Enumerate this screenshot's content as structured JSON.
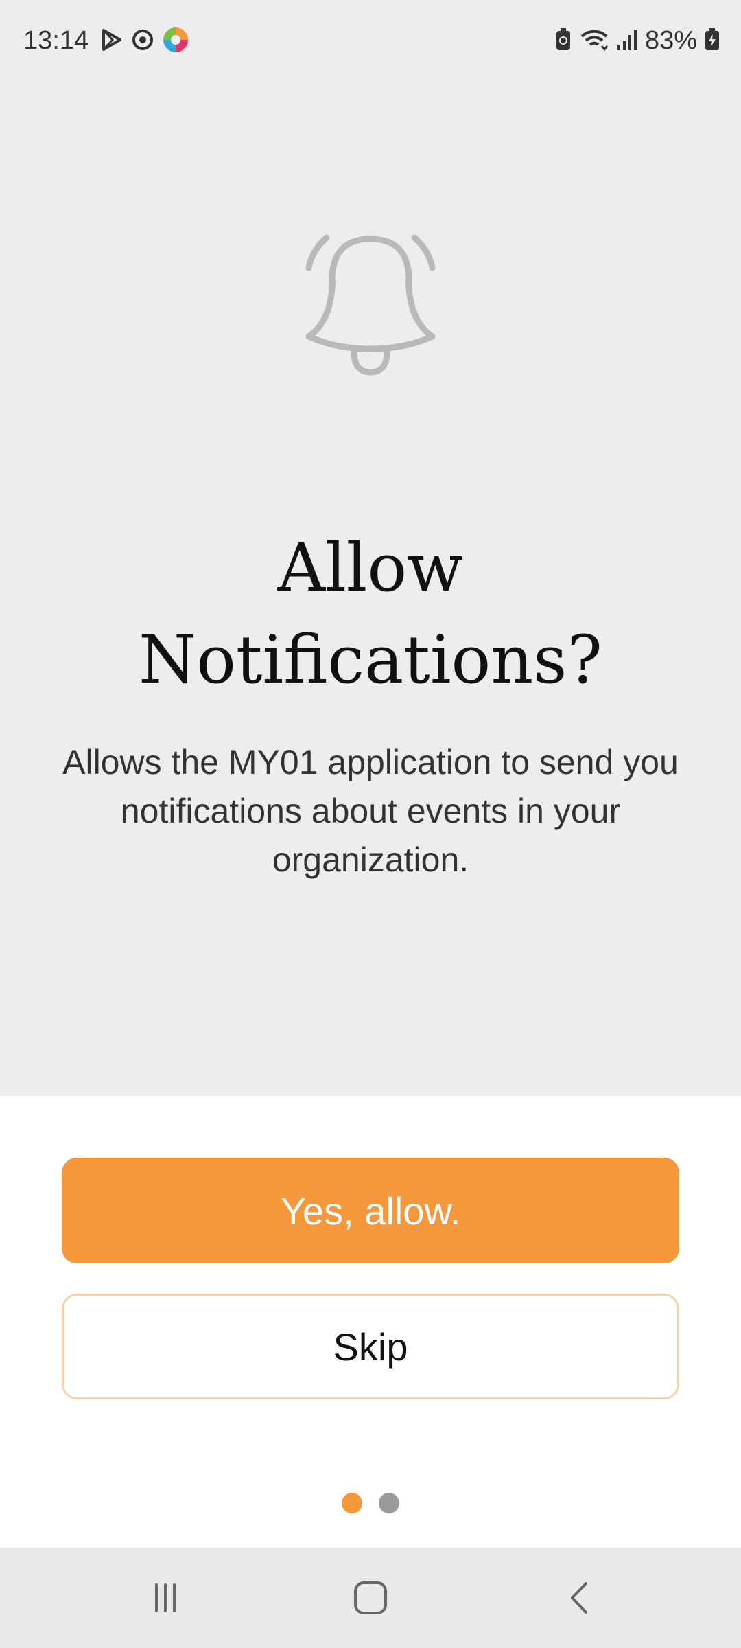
{
  "status_bar": {
    "time": "13:14",
    "battery_percent": "83%",
    "left_icons": [
      "play-icon",
      "sync-icon",
      "app-logo-icon"
    ],
    "right_icons": [
      "battery-saver-icon",
      "wifi-icon",
      "signal-icon",
      "battery-charging-icon"
    ]
  },
  "prompt": {
    "icon": "bell-icon",
    "title": "Allow Notifications?",
    "description": "Allows the MY01 application to send you notifications about events in your organization."
  },
  "actions": {
    "allow_label": "Yes, allow.",
    "skip_label": "Skip"
  },
  "pager": {
    "page_count": 2,
    "current_page": 1
  },
  "colors": {
    "accent": "#f5973b",
    "accent_light_border": "#f8d2aa",
    "background": "#ededed",
    "sheet": "#ffffff"
  },
  "nav_bar": {
    "icons": [
      "recents-icon",
      "home-icon",
      "back-icon"
    ]
  }
}
